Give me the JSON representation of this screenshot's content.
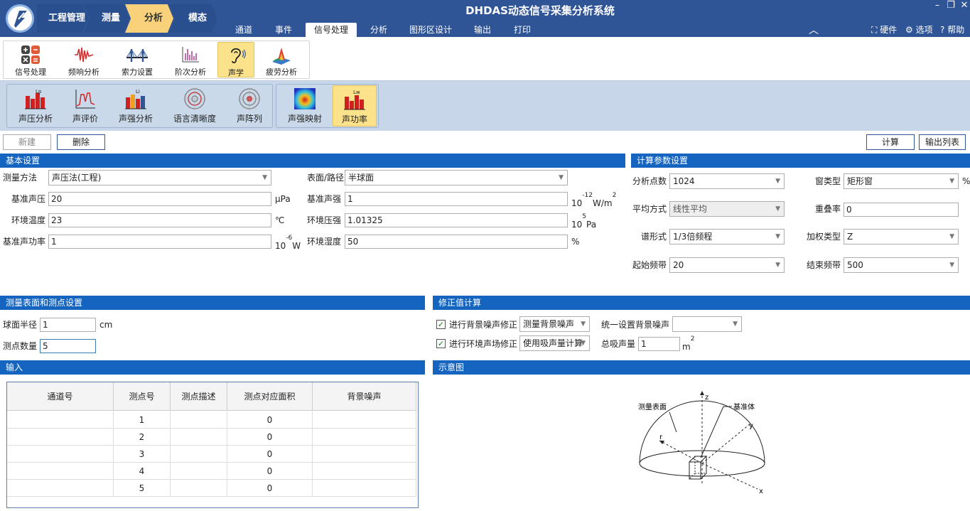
{
  "app": {
    "title": "DHDAS动态信号采集分析系统"
  },
  "breadcrumb": [
    "工程管理",
    "测量",
    "分析",
    "模态"
  ],
  "menu_tabs": [
    "通道",
    "事件",
    "信号处理",
    "分析",
    "图形区设计",
    "输出",
    "打印"
  ],
  "top_right": {
    "hardware": "硬件",
    "options": "选项",
    "help": "帮助"
  },
  "window": {
    "minimize": "–",
    "restore": "❐",
    "close": "✕"
  },
  "toolbar1": [
    "信号处理",
    "频响分析",
    "索力设置",
    "阶次分析",
    "声学",
    "疲劳分析"
  ],
  "toolbar2": [
    "声压分析",
    "声评价",
    "声强分析",
    "语言清晰度",
    "声阵列",
    "声强映射",
    "声功率"
  ],
  "toolbar2_icon_text": {
    "lp": "Lp",
    "li": "Li",
    "lw": "Lw"
  },
  "actions": {
    "new": "新建",
    "delete": "删除",
    "calc": "计算",
    "export": "输出列表"
  },
  "basic": {
    "header": "基本设置",
    "method_label": "测量方法",
    "method": "声压法(工程)",
    "surface_label": "表面/路径",
    "surface": "半球面",
    "ref_pressure_label": "基准声压",
    "ref_pressure": "20",
    "ref_pressure_unit": "μPa",
    "ref_intensity_label": "基准声强",
    "ref_intensity": "1",
    "ref_intensity_unit_a": "10",
    "ref_intensity_unit_exp": "-12",
    "ref_intensity_unit_b": "W/m",
    "ref_intensity_unit_exp2": "2",
    "temp_label": "环境温度",
    "temp": "23",
    "temp_unit": "℃",
    "pressure_label": "环境压强",
    "pressure": "1.01325",
    "pressure_unit_a": "10",
    "pressure_unit_exp": "5",
    "pressure_unit_b": "Pa",
    "ref_power_label": "基准声功率",
    "ref_power": "1",
    "ref_power_unit_a": "10",
    "ref_power_unit_exp": "-6",
    "ref_power_unit_b": "W",
    "humidity_label": "环境湿度",
    "humidity": "50",
    "humidity_unit": "%"
  },
  "calc": {
    "header": "计算参数设置",
    "points_label": "分析点数",
    "points": "1024",
    "window_label": "窗类型",
    "window": "矩形窗",
    "window_unit": "%",
    "avg_label": "平均方式",
    "avg": "线性平均",
    "overlap_label": "重叠率",
    "overlap": "0",
    "spectrum_label": "谱形式",
    "spectrum": "1/3倍频程",
    "weight_label": "加权类型",
    "weight": "Z",
    "start_label": "起始频带",
    "start": "20",
    "end_label": "结束频带",
    "end": "500"
  },
  "surface_setup": {
    "header": "测量表面和测点设置",
    "radius_label": "球面半径",
    "radius": "1",
    "radius_unit": "cm",
    "count_label": "测点数量",
    "count": "5"
  },
  "correction": {
    "header": "修正值计算",
    "bg_label": "进行背景噪声修正",
    "bg_mode": "测量背景噪声",
    "uniform_label": "统一设置背景噪声",
    "uniform": "",
    "env_label": "进行环境声场修正",
    "env_mode": "使用吸声量计算",
    "absorb_label": "总吸声量",
    "absorb": "1",
    "absorb_unit": "m",
    "absorb_unit_exp": "2"
  },
  "input": {
    "header": "输入",
    "columns": [
      "通道号",
      "测点号",
      "测点描述",
      "测点对应面积",
      "背景噪声"
    ],
    "rows": [
      {
        "ch": "",
        "pt": "1",
        "desc": "",
        "area": "0",
        "bg": ""
      },
      {
        "ch": "",
        "pt": "2",
        "desc": "",
        "area": "0",
        "bg": ""
      },
      {
        "ch": "",
        "pt": "3",
        "desc": "",
        "area": "0",
        "bg": ""
      },
      {
        "ch": "",
        "pt": "4",
        "desc": "",
        "area": "0",
        "bg": ""
      },
      {
        "ch": "",
        "pt": "5",
        "desc": "",
        "area": "0",
        "bg": ""
      }
    ]
  },
  "diagram": {
    "header": "示意图",
    "surface": "测量表面",
    "body": "基准体",
    "z": "z",
    "y": "y",
    "x": "x",
    "r": "r"
  },
  "colors": {
    "title_bar": "#2f5597",
    "section": "#1565c0",
    "active": "#fce28a",
    "ribbon2": "#c7d6e8"
  }
}
